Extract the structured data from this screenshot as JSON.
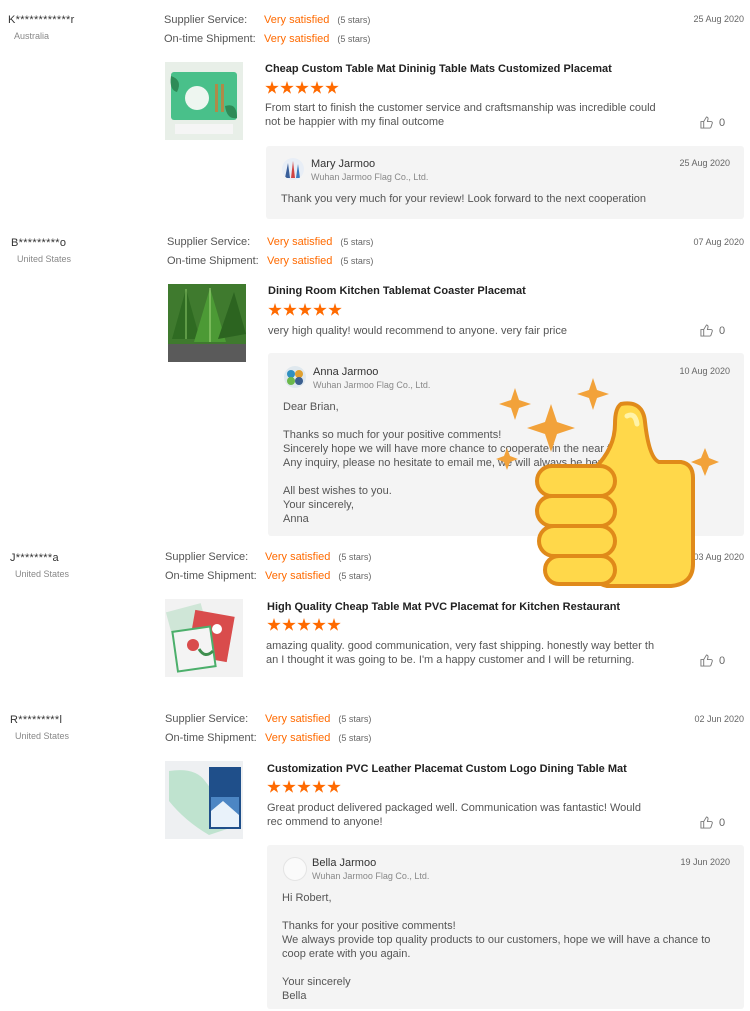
{
  "labels": {
    "supplier_service": "Supplier Service:",
    "ontime_shipment": "On-time Shipment:"
  },
  "reviews": [
    {
      "buyer": "K************r",
      "country": "Australia",
      "date": "25 Aug 2020",
      "supplier_rating": "Very satisfied",
      "supplier_stars": "(5 stars)",
      "shipment_rating": "Very satisfied",
      "shipment_stars": "(5 stars)",
      "product": "Cheap Custom Table Mat Dininig Table Mats Customized Placemat",
      "rating": 5,
      "text": "From start to finish the customer service and craftsmanship was incredible could not be happier with my final outcome",
      "likes": "0",
      "reply": {
        "name": "Mary Jarmoo",
        "company": "Wuhan Jarmoo Flag Co., Ltd.",
        "date": "25 Aug 2020",
        "text": "Thank you very much for your review! Look forward to the next cooperation"
      }
    },
    {
      "buyer": "B*********o",
      "country": "United States",
      "date": "07 Aug 2020",
      "supplier_rating": "Very satisfied",
      "supplier_stars": "(5 stars)",
      "shipment_rating": "Very satisfied",
      "shipment_stars": "(5 stars)",
      "product": "Dining Room Kitchen Tablemat Coaster Placemat",
      "rating": 5,
      "text": "very high quality! would recommend to anyone. very fair price",
      "likes": "0",
      "reply": {
        "name": "Anna Jarmoo",
        "company": "Wuhan Jarmoo Flag Co., Ltd.",
        "date": "10 Aug 2020",
        "text": "Dear Brian,\n\nThanks so much for your positive comments!\nSincerely hope we will have more chance to cooperate in the near future.\nAny inquiry, please no hesitate to email me, we will always be here for you !\n\nAll best wishes to you.\nYour sincerely,\nAnna"
      }
    },
    {
      "buyer": "J********a",
      "country": "United States",
      "date": "03 Aug 2020",
      "supplier_rating": "Very satisfied",
      "supplier_stars": "(5 stars)",
      "shipment_rating": "Very satisfied",
      "shipment_stars": "(5 stars)",
      "product": "High Quality Cheap Table Mat PVC Placemat for Kitchen Restaurant",
      "rating": 5,
      "text": "amazing quality. good communication, very fast shipping.  honestly way better th an I thought it was going to be. I'm a happy customer and I will be returning.",
      "likes": "0"
    },
    {
      "buyer": "R*********l",
      "country": "United States",
      "date": "02 Jun 2020",
      "supplier_rating": "Very satisfied",
      "supplier_stars": "(5 stars)",
      "shipment_rating": "Very satisfied",
      "shipment_stars": "(5 stars)",
      "product": "Customization PVC Leather Placemat Custom Logo Dining Table Mat",
      "rating": 5,
      "text": "Great product delivered packaged well.  Communication was fantastic!  Would rec ommend to anyone!",
      "likes": "0",
      "reply": {
        "name": "Bella Jarmoo",
        "company": "Wuhan Jarmoo Flag Co., Ltd.",
        "date": "19 Jun 2020",
        "text": "Hi Robert,\n\nThanks for your positive comments!\nWe always provide top quality products to our customers, hope we will have a chance to coop erate with you again.\n\nYour sincerely\nBella"
      }
    }
  ]
}
